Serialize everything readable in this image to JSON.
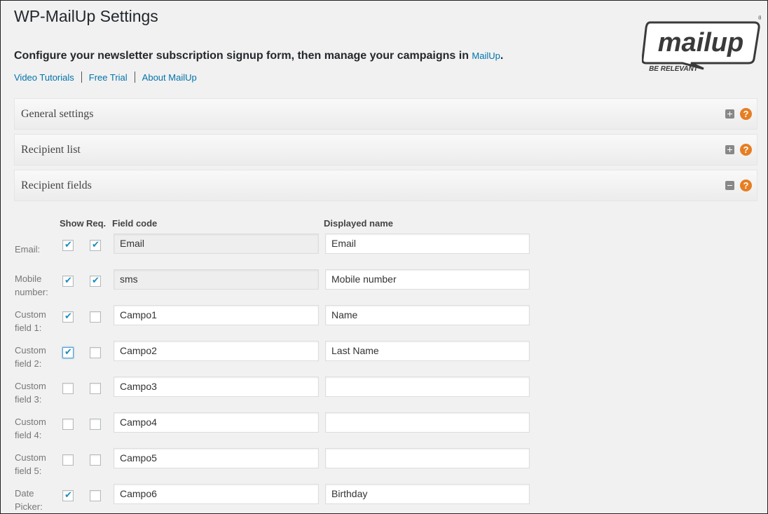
{
  "header": {
    "title": "WP-MailUp Settings",
    "intro": "Configure your newsletter subscription signup form, then manage your campaigns in ",
    "intro_link": "MailUp",
    "intro_end": "."
  },
  "links": [
    "Video Tutorials",
    "Free Trial",
    "About MailUp"
  ],
  "logo": {
    "text": "mailup",
    "tagline": "BE RELEVANT",
    "mark": "®",
    "color": "#3a3a3a"
  },
  "panels": [
    {
      "title": "General settings",
      "state": "collapsed",
      "help": "?"
    },
    {
      "title": "Recipient list",
      "state": "collapsed",
      "help": "?"
    },
    {
      "title": "Recipient fields",
      "state": "expanded",
      "help": "?"
    }
  ],
  "table": {
    "headers": {
      "show": "Show",
      "req": "Req.",
      "code": "Field code",
      "display": "Displayed name"
    },
    "rows": [
      {
        "label_1": "Email:",
        "label_2": "",
        "show": true,
        "req": true,
        "code": "Email",
        "code_readonly": true,
        "display": "Email"
      },
      {
        "label_1": "Mobile",
        "label_2": "number:",
        "show": true,
        "req": true,
        "code": "sms",
        "code_readonly": true,
        "display": "Mobile number"
      },
      {
        "label_1": "Custom",
        "label_2": "field 1:",
        "show": true,
        "req": false,
        "code": "Campo1",
        "code_readonly": false,
        "display": "Name"
      },
      {
        "label_1": "Custom",
        "label_2": "field 2:",
        "show": true,
        "req": false,
        "code": "Campo2",
        "code_readonly": false,
        "display": "Last Name"
      },
      {
        "label_1": "Custom",
        "label_2": "field 3:",
        "show": false,
        "req": false,
        "code": "Campo3",
        "code_readonly": false,
        "display": ""
      },
      {
        "label_1": "Custom",
        "label_2": "field 4:",
        "show": false,
        "req": false,
        "code": "Campo4",
        "code_readonly": false,
        "display": ""
      },
      {
        "label_1": "Custom",
        "label_2": "field 5:",
        "show": false,
        "req": false,
        "code": "Campo5",
        "code_readonly": false,
        "display": ""
      },
      {
        "label_1": "Date",
        "label_2": "Picker:",
        "show": true,
        "req": false,
        "code": "Campo6",
        "code_readonly": false,
        "display": "Birthday"
      }
    ]
  },
  "colors": {
    "link": "#0073aa",
    "help": "#e67e22",
    "check": "#1e8cbe"
  }
}
